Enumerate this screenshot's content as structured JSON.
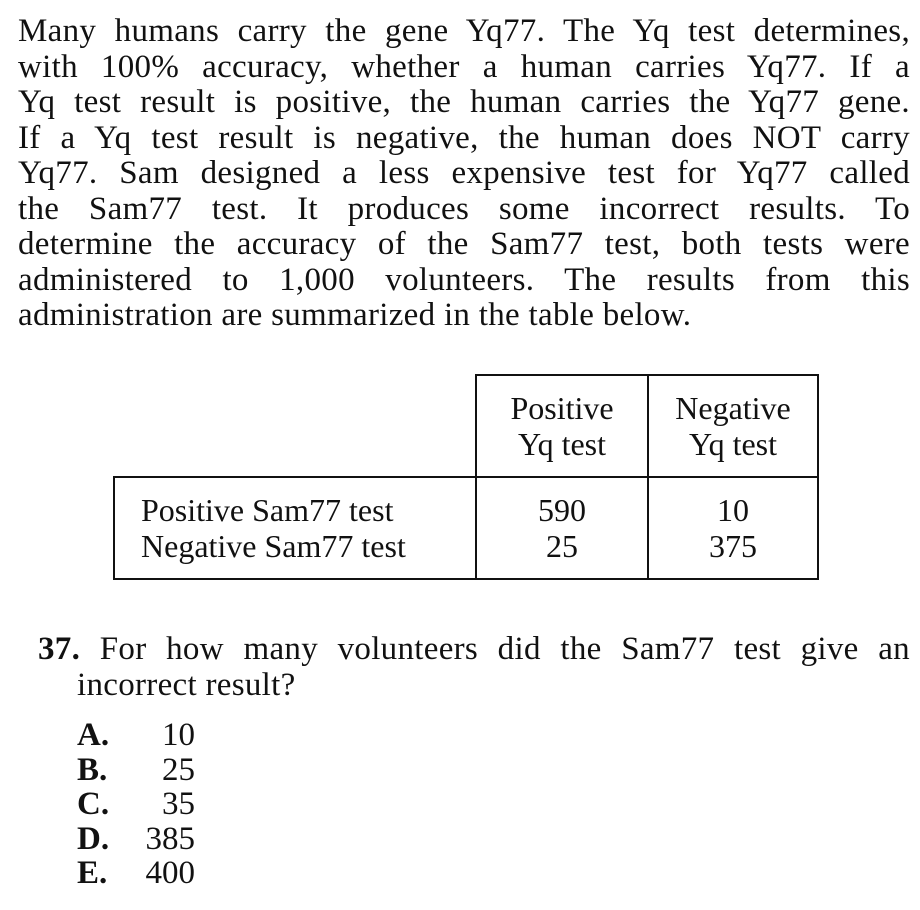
{
  "passage": {
    "lines": [
      "Many humans carry the gene Yq77. The Yq test determines,",
      "with 100% accuracy, whether a human carries Yq77. If a",
      "Yq test result is positive, the human carries the Yq77 gene.",
      "If a Yq test result is negative, the human does NOT carry",
      "Yq77. Sam designed a less expensive test for Yq77 called",
      "the Sam77 test. It produces some incorrect results. To",
      "determine the accuracy of the Sam77 test, both tests were",
      "administered to 1,000 volunteers. The results from this",
      "administration are summarized in the table below."
    ]
  },
  "table": {
    "col_headers": [
      {
        "line1": "Positive",
        "line2": "Yq test"
      },
      {
        "line1": "Negative",
        "line2": "Yq test"
      }
    ],
    "row_labels": [
      "Positive Sam77 test",
      "Negative Sam77 test"
    ],
    "cells": {
      "positive_yq": [
        "590",
        "25"
      ],
      "negative_yq": [
        "10",
        "375"
      ]
    }
  },
  "question": {
    "number": "37.",
    "text_line1": "For how many volunteers did the Sam77 test give an",
    "text_line2": "incorrect result?"
  },
  "choices": [
    {
      "letter": "A.",
      "value": "10"
    },
    {
      "letter": "B.",
      "value": "25"
    },
    {
      "letter": "C.",
      "value": "35"
    },
    {
      "letter": "D.",
      "value": "385"
    },
    {
      "letter": "E.",
      "value": "400"
    }
  ]
}
